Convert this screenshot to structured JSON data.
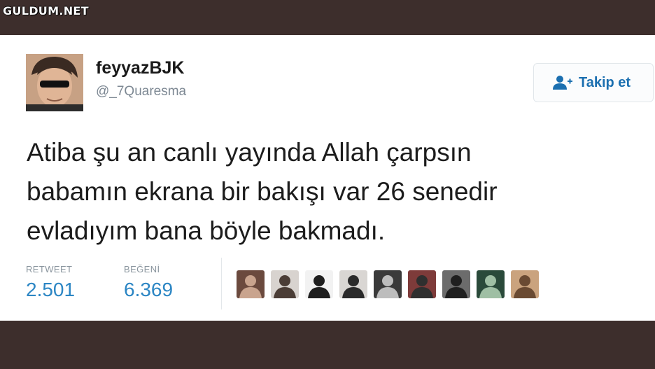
{
  "watermark": "GULDUM.NET",
  "tweet": {
    "username": "feyyazBJK",
    "handle": "@_7Quaresma",
    "follow_label": "Takip et",
    "lines": [
      "Atiba şu an canlı yayında Allah çarpsın",
      "babamın ekrana bir bakışı var 26 senedir",
      "evladıyım bana böyle bakmadı."
    ],
    "retweet_label": "RETWEET",
    "retweet_count": "2.501",
    "like_label": "BEĞENİ",
    "like_count": "6.369"
  },
  "colors": {
    "accent": "#2c86c4",
    "follow_text": "#1b6fb0",
    "frame": "#3d2e2c"
  },
  "likers": [
    {
      "icon": "liker-avatar-1",
      "bg": "#6b4a3e",
      "fg": "#c9a48e"
    },
    {
      "icon": "liker-avatar-2",
      "bg": "#d8d3cf",
      "fg": "#4b3d36"
    },
    {
      "icon": "liker-avatar-3",
      "bg": "#f2f2f2",
      "fg": "#1e1e1e"
    },
    {
      "icon": "liker-avatar-4",
      "bg": "#d9d6d3",
      "fg": "#2a2a2a"
    },
    {
      "icon": "liker-avatar-5",
      "bg": "#3a3a3a",
      "fg": "#bdbdbd"
    },
    {
      "icon": "liker-avatar-6",
      "bg": "#7e3b3a",
      "fg": "#2f2f2f"
    },
    {
      "icon": "liker-avatar-7",
      "bg": "#6c6c6c",
      "fg": "#1f1f1f"
    },
    {
      "icon": "liker-avatar-8",
      "bg": "#2a4a3a",
      "fg": "#9fbfa4"
    },
    {
      "icon": "liker-avatar-9",
      "bg": "#caa37e",
      "fg": "#6a4a32"
    }
  ]
}
